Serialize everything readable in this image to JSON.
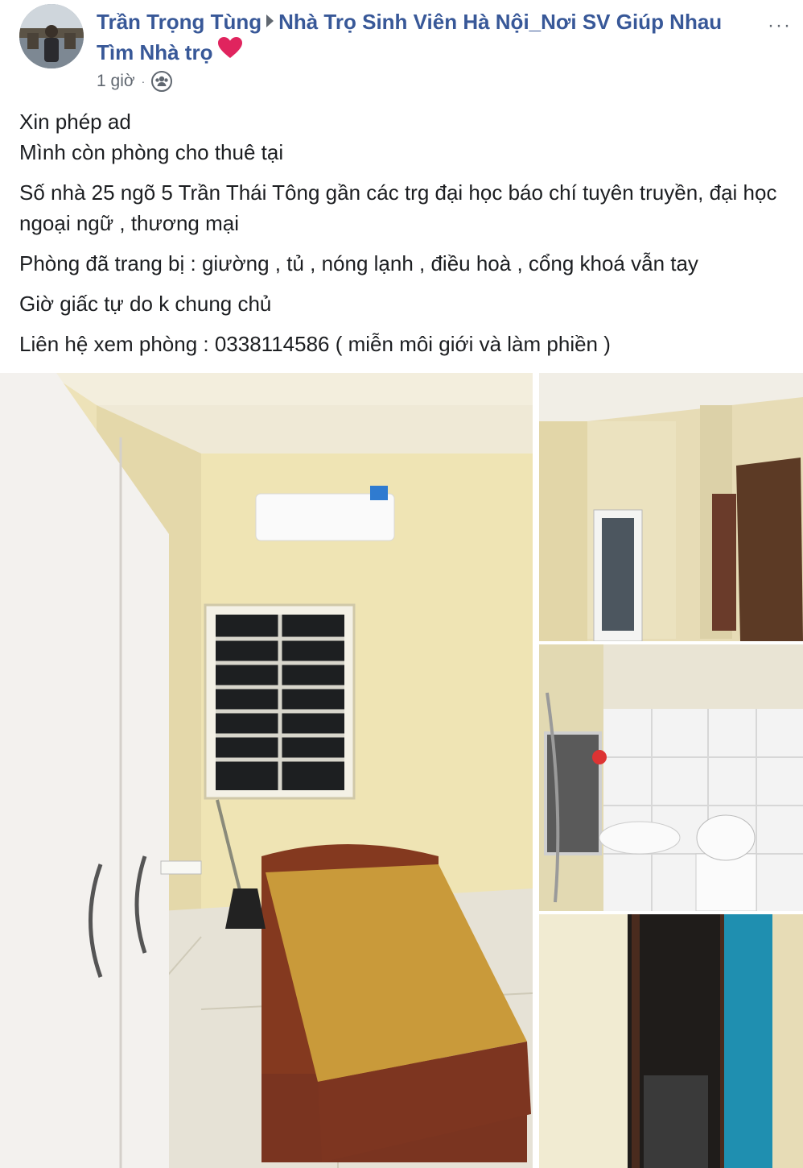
{
  "post": {
    "author": "Trần Trọng Tùng",
    "group": "Nhà Trọ Sinh Viên Hà Nội_Nơi SV Giúp Nhau Tìm Nhà trọ",
    "timestamp": "1 giờ",
    "audience_icon": "group-icon",
    "more_label": "···",
    "lines": [
      "Xin phép ad",
      "Mình còn phòng cho thuê tại",
      "Số nhà 25 ngõ 5 Trần Thái Tông gần các trg đại học báo chí tuyên truyền, đại học ngoại ngữ , thương mại",
      "Phòng đã trang bị : giường , tủ , nóng lạnh , điều hoà , cổng khoá vẫn tay",
      "Giờ giấc tự do k chung chủ",
      "Liên hệ xem phòng : 0338114586 ( miễn môi giới và làm phiền )"
    ]
  },
  "colors": {
    "link": "#385898",
    "meta": "#606770",
    "text": "#1c1e21",
    "heart": "#e0245e"
  },
  "photos": [
    {
      "name": "bedroom-photo"
    },
    {
      "name": "hallway-photo"
    },
    {
      "name": "bathroom-photo"
    },
    {
      "name": "door-photo"
    }
  ]
}
